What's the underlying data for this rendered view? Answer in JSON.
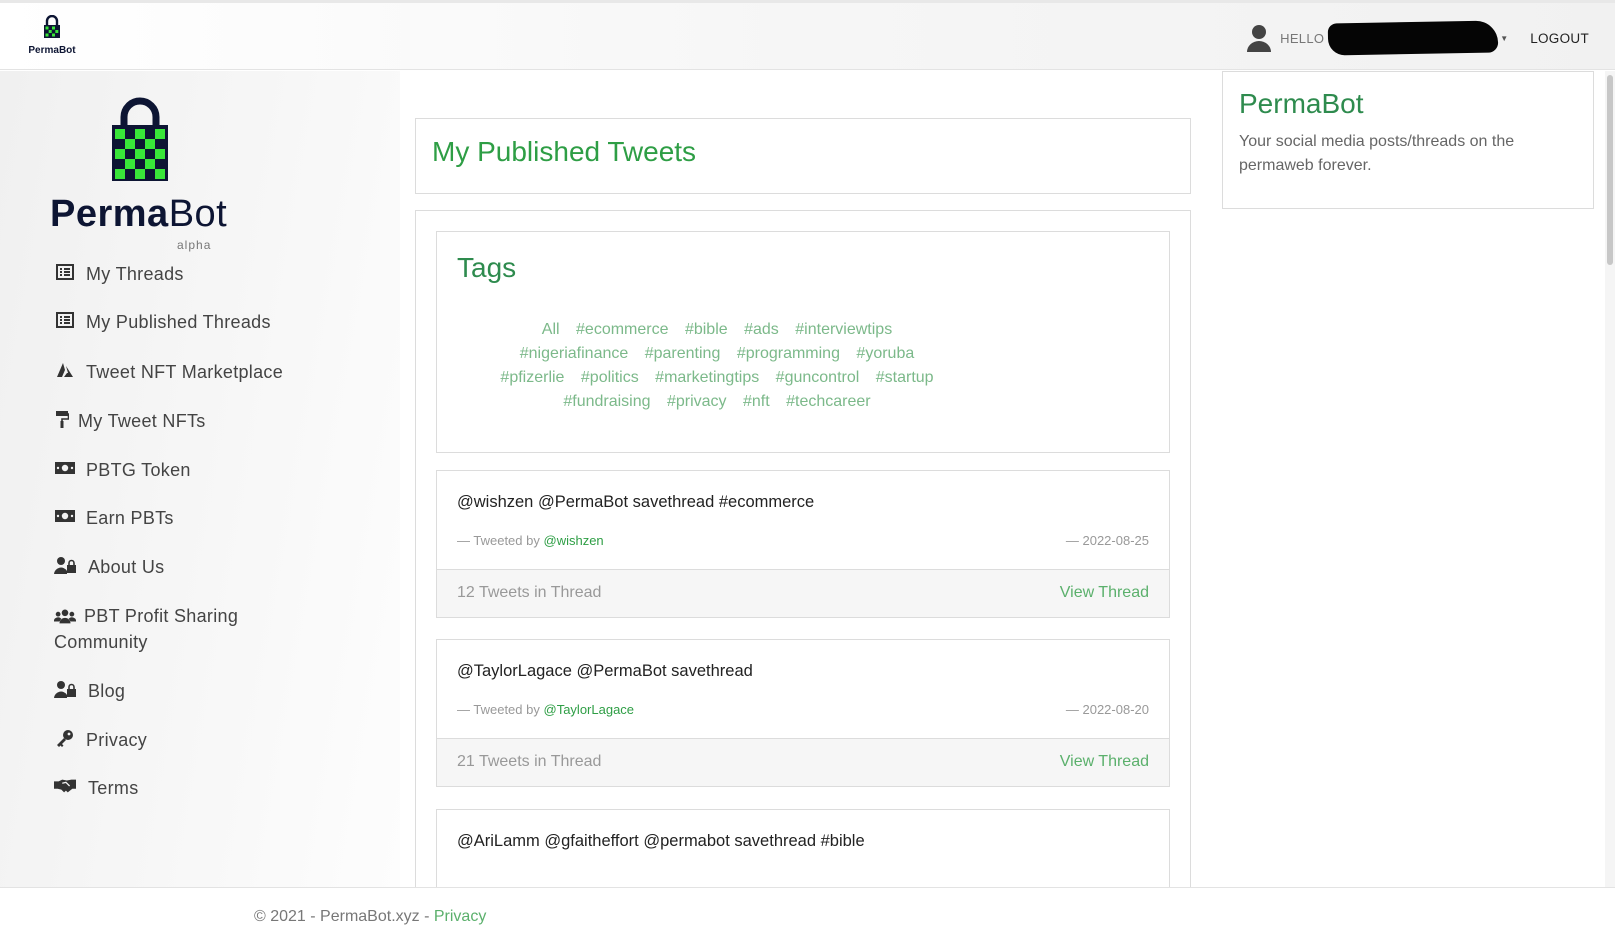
{
  "nav": {
    "logo_text": "PermaBot",
    "hello": "HELLO",
    "logout": "LOGOUT"
  },
  "sidebar": {
    "brand_bold": "Perma",
    "brand_light": "Bot",
    "brand_tag": "alpha",
    "items": [
      {
        "label": "My Threads",
        "icon": "list-icon"
      },
      {
        "label": "My Published Threads",
        "icon": "list-icon"
      },
      {
        "label": "Tweet NFT Marketplace",
        "icon": "marketplace-icon"
      },
      {
        "label": "My Tweet NFTs",
        "icon": "paint-roller-icon"
      },
      {
        "label": "PBTG Token",
        "icon": "money-icon"
      },
      {
        "label": "Earn PBTs",
        "icon": "money-icon"
      },
      {
        "label": "About Us",
        "icon": "user-lock-icon"
      },
      {
        "label": "PBT Profit Sharing Community",
        "icon": "users-icon"
      },
      {
        "label": "Blog",
        "icon": "user-lock-icon"
      },
      {
        "label": "Privacy",
        "icon": "key-icon"
      },
      {
        "label": "Terms",
        "icon": "handshake-icon"
      }
    ]
  },
  "main": {
    "title": "My Published Tweets",
    "tags_title": "Tags",
    "tags": [
      "All",
      "#ecommerce",
      "#bible",
      "#ads",
      "#interviewtips",
      "#nigeriafinance",
      "#parenting",
      "#programming",
      "#yoruba",
      "#pfizerlie",
      "#politics",
      "#marketingtips",
      "#guncontrol",
      "#startup",
      "#fundraising",
      "#privacy",
      "#nft",
      "#techcareer"
    ],
    "threads": [
      {
        "text": "@wishzen @PermaBot savethread #ecommerce",
        "by_prefix": "— Tweeted by",
        "author": "@wishzen",
        "date": "— 2022-08-25",
        "count": "12 Tweets in Thread",
        "view": "View Thread"
      },
      {
        "text": "@TaylorLagace @PermaBot savethread",
        "by_prefix": "— Tweeted by",
        "author": "@TaylorLagace",
        "date": "— 2022-08-20",
        "count": "21 Tweets in Thread",
        "view": "View Thread"
      },
      {
        "text": "@AriLamm @gfaitheffort @permabot savethread #bible"
      }
    ]
  },
  "info": {
    "title": "PermaBot",
    "text": "Your social media posts/threads on the permaweb forever."
  },
  "footer": {
    "text": "© 2021 - PermaBot.xyz -",
    "link": "Privacy"
  },
  "colors": {
    "accent": "#2e9e45",
    "brand_navy": "#0d1533",
    "lock_green": "#39e639"
  }
}
